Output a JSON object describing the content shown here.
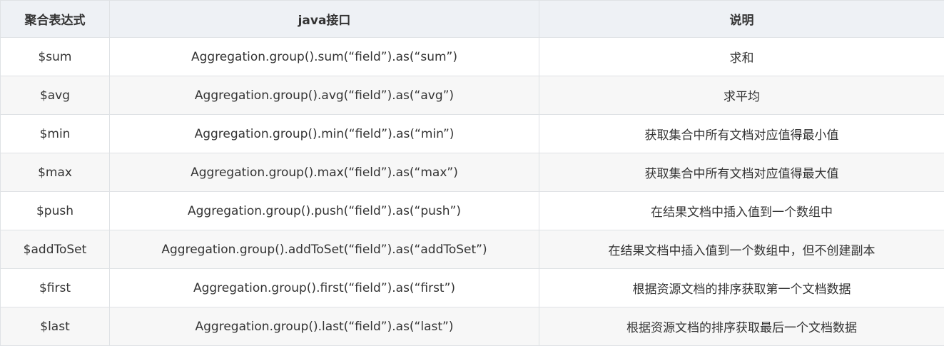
{
  "table": {
    "headers": [
      "聚合表达式",
      "java接口",
      "说明"
    ],
    "rows": [
      [
        "$sum",
        "Aggregation.group().sum(“field”).as(“sum”)",
        "求和"
      ],
      [
        "$avg",
        "Aggregation.group().avg(“field”).as(“avg”)",
        "求平均"
      ],
      [
        "$min",
        "Aggregation.group().min(“field”).as(“min”)",
        "获取集合中所有文档对应值得最小值"
      ],
      [
        "$max",
        "Aggregation.group().max(“field”).as(“max”)",
        "获取集合中所有文档对应值得最大值"
      ],
      [
        "$push",
        "Aggregation.group().push(“field”).as(“push”)",
        "在结果文档中插入值到一个数组中"
      ],
      [
        "$addToSet",
        "Aggregation.group().addToSet(“field”).as(“addToSet”)",
        "在结果文档中插入值到一个数组中，但不创建副本"
      ],
      [
        "$first",
        "Aggregation.group().first(“field”).as(“first”)",
        "根据资源文档的排序获取第一个文档数据"
      ],
      [
        "$last",
        "Aggregation.group().last(“field”).as(“last”)",
        "根据资源文档的排序获取最后一个文档数据"
      ]
    ]
  }
}
